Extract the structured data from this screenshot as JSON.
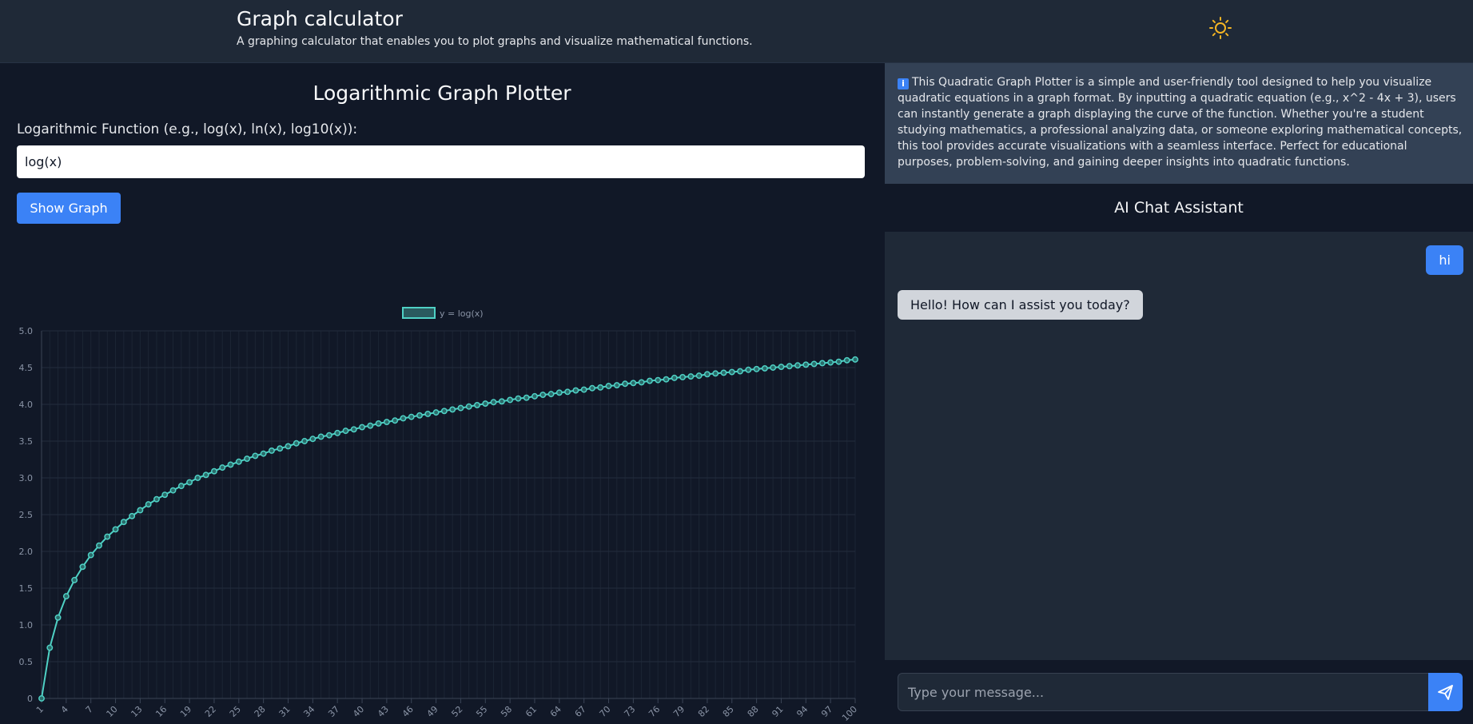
{
  "header": {
    "title": "Graph calculator",
    "subtitle": "A graphing calculator that enables you to plot graphs and visualize mathematical functions.",
    "theme_icon": "sun-icon"
  },
  "plotter": {
    "title": "Logarithmic Graph Plotter",
    "input_label": "Logarithmic Function (e.g., log(x), ln(x), log10(x)):",
    "input_value": "log(x)",
    "button_label": "Show Graph"
  },
  "info": {
    "icon": "info-icon",
    "icon_glyph": "i",
    "text": "This Quadratic Graph Plotter is a simple and user-friendly tool designed to help you visualize quadratic equations in a graph format. By inputting a quadratic equation (e.g., x^2 - 4x + 3), users can instantly generate a graph displaying the curve of the function. Whether you're a student studying mathematics, a professional analyzing data, or someone exploring mathematical concepts, this tool provides accurate visualizations with a seamless interface. Perfect for educational purposes, problem-solving, and gaining deeper insights into quadratic functions."
  },
  "chat": {
    "title": "AI Chat Assistant",
    "messages": [
      {
        "role": "user",
        "text": "hi"
      },
      {
        "role": "assistant",
        "text": "Hello! How can I assist you today?"
      }
    ],
    "input_placeholder": "Type your message...",
    "send_icon": "send-icon"
  },
  "colors": {
    "accent": "#3b82f6",
    "series": "#4fd1c5",
    "theme_icon": "#f5b524"
  },
  "chart_data": {
    "type": "line",
    "function": "log(x)",
    "x_start": 1,
    "x_end": 100,
    "x_step": 1,
    "x_tick_labels": [
      "1",
      "4",
      "7",
      "10",
      "13",
      "16",
      "19",
      "22",
      "25",
      "28",
      "31",
      "34",
      "37",
      "40",
      "43",
      "46",
      "49",
      "52",
      "55",
      "58",
      "61",
      "64",
      "67",
      "70",
      "73",
      "76",
      "79",
      "82",
      "85",
      "88",
      "91",
      "94",
      "97",
      "100"
    ],
    "y_tick_labels": [
      "0",
      "0.5",
      "1.0",
      "1.5",
      "2.0",
      "2.5",
      "3.0",
      "3.5",
      "4.0",
      "4.5",
      "5.0"
    ],
    "ylim": [
      0,
      5
    ],
    "series": [
      {
        "name": "y = log(x)",
        "values": [
          0,
          0.69,
          1.1,
          1.39,
          1.61,
          1.79,
          1.95,
          2.08,
          2.2,
          2.3,
          2.4,
          2.48,
          2.56,
          2.64,
          2.71,
          2.77,
          2.83,
          2.89,
          2.94,
          3,
          3.04,
          3.09,
          3.14,
          3.18,
          3.22,
          3.26,
          3.3,
          3.33,
          3.37,
          3.4,
          3.43,
          3.47,
          3.5,
          3.53,
          3.56,
          3.58,
          3.61,
          3.64,
          3.66,
          3.69,
          3.71,
          3.74,
          3.76,
          3.78,
          3.81,
          3.83,
          3.85,
          3.87,
          3.89,
          3.91,
          3.93,
          3.95,
          3.97,
          3.99,
          4.01,
          4.03,
          4.04,
          4.06,
          4.08,
          4.09,
          4.11,
          4.13,
          4.14,
          4.16,
          4.17,
          4.19,
          4.2,
          4.22,
          4.23,
          4.25,
          4.26,
          4.28,
          4.29,
          4.3,
          4.32,
          4.33,
          4.34,
          4.36,
          4.37,
          4.38,
          4.39,
          4.41,
          4.42,
          4.43,
          4.44,
          4.45,
          4.47,
          4.48,
          4.49,
          4.5,
          4.51,
          4.52,
          4.53,
          4.54,
          4.55,
          4.56,
          4.57,
          4.58,
          4.6,
          4.61
        ]
      }
    ],
    "legend_position": "top-center",
    "grid": true
  }
}
